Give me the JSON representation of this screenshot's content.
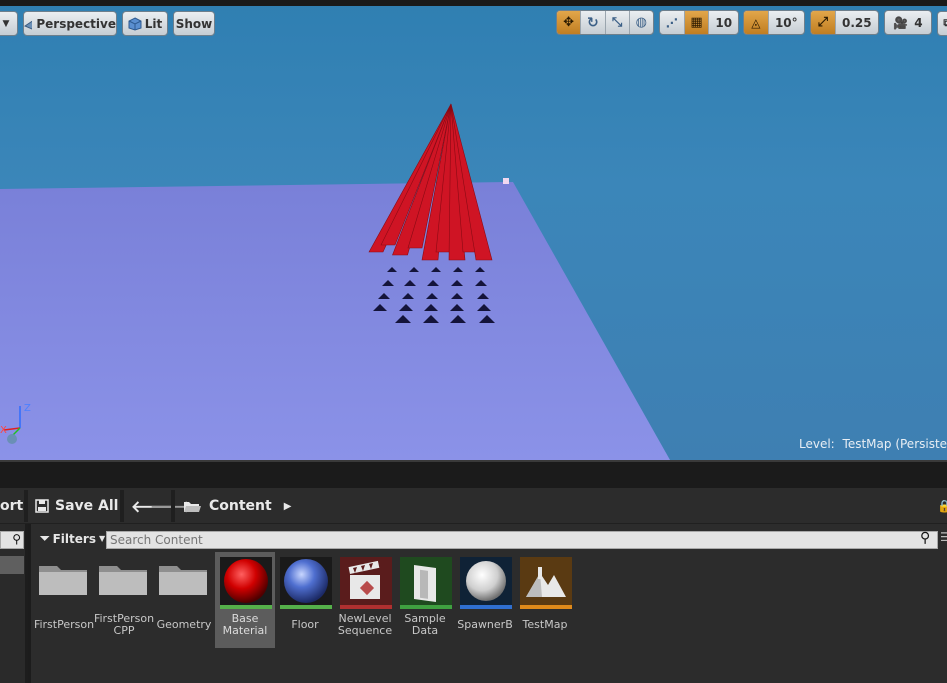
{
  "viewport": {
    "toolbar": {
      "perspective_label": "Perspective",
      "lit_label": "Lit",
      "show_label": "Show",
      "grid_snap_value": "10",
      "rotation_snap_value": "10°",
      "scale_snap_value": "0.25",
      "camera_speed_value": "4"
    },
    "level_label": "Level:",
    "level_name": "TestMap (Persistent)",
    "axis_labels": {
      "z": "Z",
      "x": "X"
    }
  },
  "content_browser": {
    "import_label": "ort",
    "save_all_label": "Save All",
    "breadcrumb_root": "Content",
    "filters_label": "Filters",
    "search_placeholder": "Search Content",
    "assets": [
      {
        "name": "FirstPerson",
        "type": "folder"
      },
      {
        "name": "FirstPerson\nCPP",
        "type": "folder"
      },
      {
        "name": "Geometry",
        "type": "folder"
      },
      {
        "name": "Base\nMaterial",
        "type": "material",
        "selected": true,
        "color": "#cc0000"
      },
      {
        "name": "Floor",
        "type": "material",
        "color": "#3e63c4"
      },
      {
        "name": "NewLevel\nSequence",
        "type": "sequence"
      },
      {
        "name": "Sample\nData",
        "type": "data"
      },
      {
        "name": "SpawnerB",
        "type": "blueprint"
      },
      {
        "name": "TestMap",
        "type": "level"
      }
    ]
  },
  "colors": {
    "sky": "#3b86b9",
    "floor": "#7f85e0",
    "spikes": "#d01020",
    "accent_orange": "#d49335",
    "panel_bg": "#2c2c2c"
  }
}
